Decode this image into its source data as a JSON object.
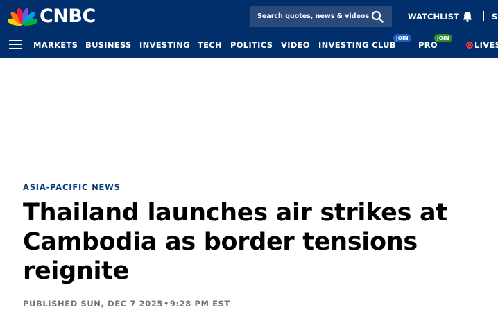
{
  "brand": {
    "logo_text": "CNBC",
    "header_color": "#002f6c"
  },
  "search": {
    "placeholder": "Search quotes, news & videos",
    "icon": "search-icon"
  },
  "account": {
    "watchlist_label": "WATCHLIST",
    "signin_label": "S"
  },
  "nav": {
    "items": [
      {
        "label": "MARKETS"
      },
      {
        "label": "BUSINESS"
      },
      {
        "label": "INVESTING"
      },
      {
        "label": "TECH"
      },
      {
        "label": "POLITICS"
      },
      {
        "label": "VIDEO"
      },
      {
        "label": "INVESTING CLUB",
        "badge": "JOIN",
        "badge_color": "#1a5fc7"
      },
      {
        "label": "PRO",
        "badge": "JOIN",
        "badge_color": "#2f8a2f"
      },
      {
        "label": "LIVEST"
      }
    ]
  },
  "article": {
    "kicker": "ASIA-PACIFIC NEWS",
    "headline": "Thailand launches air strikes at Cambodia as border tensions reignite",
    "published_label": "PUBLISHED SUN, DEC 7 2025",
    "separator": "•",
    "published_time": "9:28 PM EST"
  },
  "colors": {
    "kicker": "#0c3f7a",
    "meta": "#747474",
    "live": "#ff3b30"
  }
}
